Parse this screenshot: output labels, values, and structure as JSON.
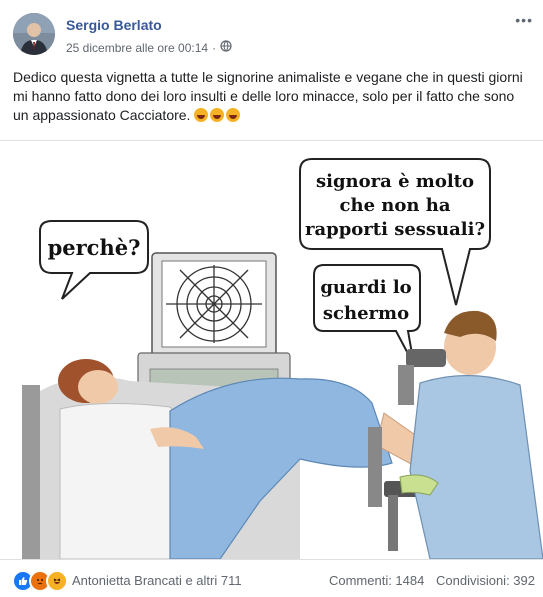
{
  "post": {
    "author": "Sergio Berlato",
    "timestamp": "25 dicembre alle ore 00:14",
    "privacy_icon": "globe-icon",
    "more_label": "•••",
    "text": "Dedico questa vignetta a tutte le signorine animaliste e vegane che in questi giorni mi hanno fatto dono dei loro insulti e delle loro minacce, solo per il fatto che sono un appassionato Cacciatore."
  },
  "image": {
    "bubble_left": "perchè?",
    "bubble_top_line1": "signora è molto",
    "bubble_top_line2": "che non ha",
    "bubble_top_line3": "rapporti sessuali?",
    "bubble_mid_line1": "guardi lo",
    "bubble_mid_line2": "schermo"
  },
  "footer": {
    "reaction_names": "Antonietta Brancati e altri 711",
    "comments": "Commenti: 1484",
    "shares": "Condivisioni: 392"
  }
}
